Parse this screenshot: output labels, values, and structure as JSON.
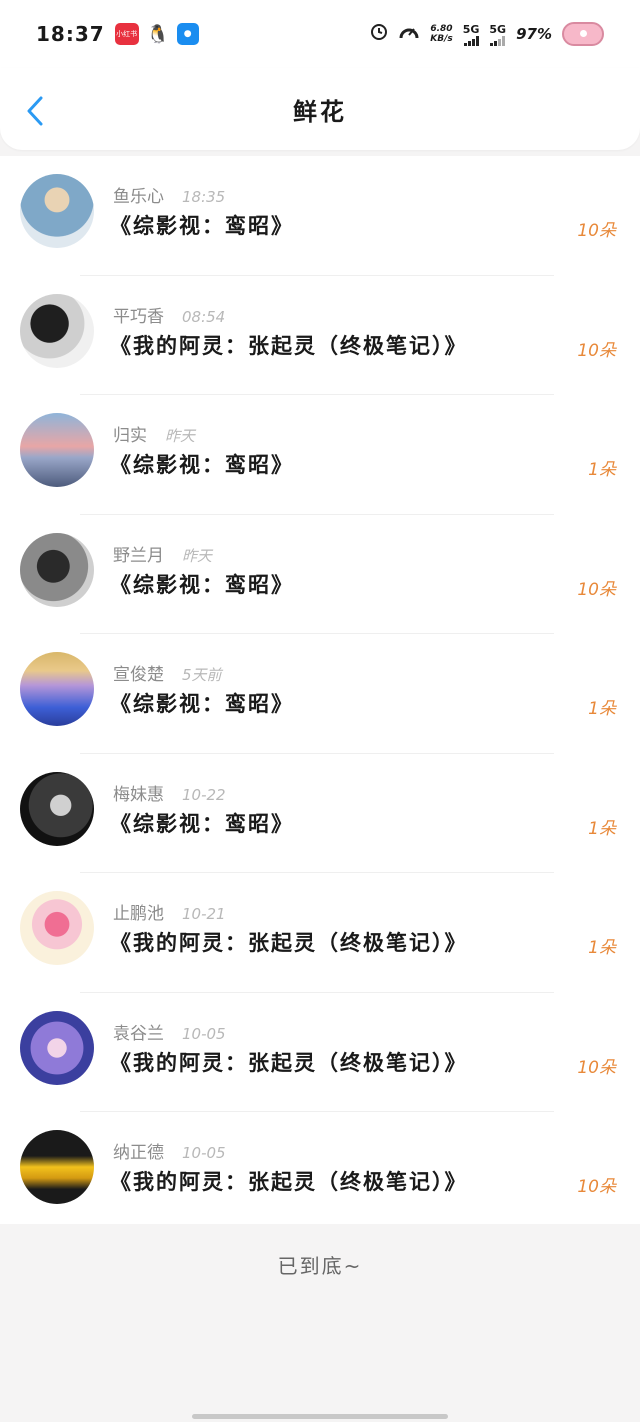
{
  "status_bar": {
    "time": "18:37",
    "speed_value": "6.80",
    "speed_unit": "KB/s",
    "network1": "5G",
    "network2": "5G",
    "battery": "97%",
    "app_badge_text": "小红书"
  },
  "header": {
    "title": "鲜花"
  },
  "list": {
    "items": [
      {
        "user": "鱼乐心",
        "time": "18:35",
        "book": "《综影视：鸾昭》",
        "count": "10朵",
        "avatar_color": "#8fb0c9"
      },
      {
        "user": "平巧香",
        "time": "08:54",
        "book": "《我的阿灵：张起灵（终极笔记）》",
        "count": "10朵",
        "avatar_color": "#4a4a4a"
      },
      {
        "user": "归实",
        "time": "昨天",
        "book": "《综影视：鸾昭》",
        "count": "1朵",
        "avatar_color": "#d88a8a"
      },
      {
        "user": "野兰月",
        "time": "昨天",
        "book": "《综影视：鸾昭》",
        "count": "10朵",
        "avatar_color": "#6a6a6a"
      },
      {
        "user": "宣俊楚",
        "time": "5天前",
        "book": "《综影视：鸾昭》",
        "count": "1朵",
        "avatar_color": "#7a6fd0"
      },
      {
        "user": "梅妹惠",
        "time": "10-22",
        "book": "《综影视：鸾昭》",
        "count": "1朵",
        "avatar_color": "#2b2b2b"
      },
      {
        "user": "止鹏池",
        "time": "10-21",
        "book": "《我的阿灵：张起灵（终极笔记）》",
        "count": "1朵",
        "avatar_color": "#f4b7c5"
      },
      {
        "user": "袁谷兰",
        "time": "10-05",
        "book": "《我的阿灵：张起灵（终极笔记）》",
        "count": "10朵",
        "avatar_color": "#6d5fc4"
      },
      {
        "user": "纳正德",
        "time": "10-05",
        "book": "《我的阿灵：张起灵（终极笔记）》",
        "count": "10朵",
        "avatar_color": "#e0b020"
      }
    ]
  },
  "footer": {
    "end_text": "已到底~"
  }
}
